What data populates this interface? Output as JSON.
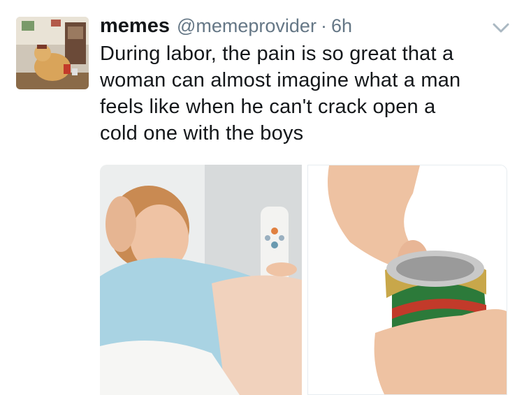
{
  "tweet": {
    "display_name": "memes",
    "handle": "@memeprovider",
    "separator": "·",
    "time": "6h",
    "text_lines": [
      "During labor, the pain is so great that a",
      "woman can almost imagine what a man",
      "feels like when he can't crack open a",
      "cold one with the boys"
    ]
  },
  "icons": {
    "avatar": "avatar-dog-photo",
    "caret": "chevron-down-icon"
  },
  "colors": {
    "text": "#14171a",
    "secondary": "#657786",
    "caret": "#aab8c2"
  },
  "media": [
    {
      "name": "woman-in-labor-photo"
    },
    {
      "name": "hand-opening-can-photo"
    }
  ]
}
